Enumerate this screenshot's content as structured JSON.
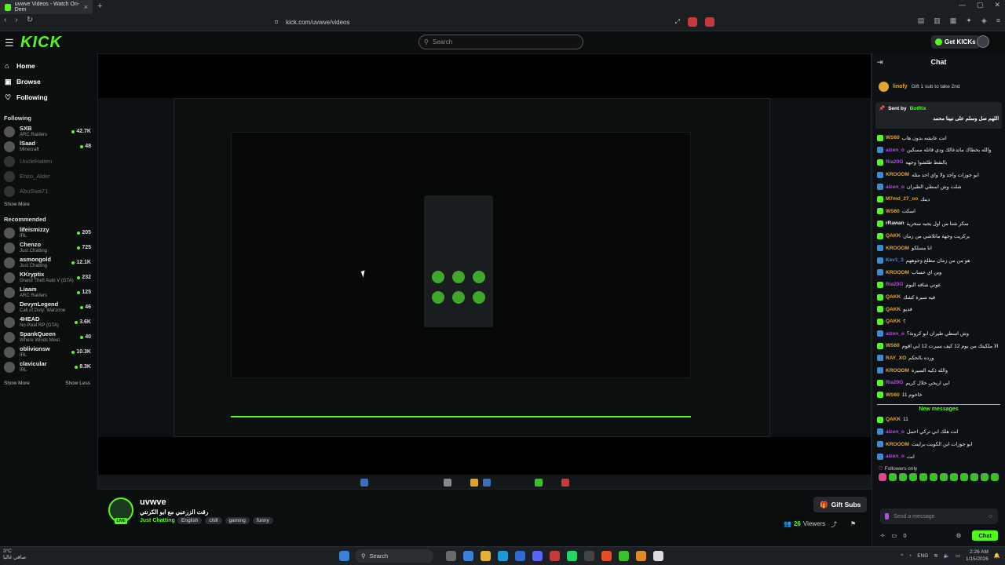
{
  "browser": {
    "tab_title": "uvwve Videos - Watch On-Dem",
    "url": "kick.com/uvwve/videos"
  },
  "header": {
    "logo": "KICK",
    "search_placeholder": "Search",
    "get_kicks": "Get KICKs"
  },
  "sidebar": {
    "nav": [
      {
        "label": "Home",
        "icon": "home-icon"
      },
      {
        "label": "Browse",
        "icon": "browse-icon"
      },
      {
        "label": "Following",
        "icon": "heart-icon"
      }
    ],
    "following_title": "Following",
    "following": [
      {
        "name": "SXB",
        "category": "ARC Raiders",
        "viewers": "42.7K",
        "online": true
      },
      {
        "name": "lSaad",
        "category": "Minecraft",
        "viewers": "48",
        "online": true
      },
      {
        "name": "UncleHatten",
        "category": "",
        "viewers": "",
        "online": false
      },
      {
        "name": "Enzo_Alder",
        "category": "",
        "viewers": "",
        "online": false
      },
      {
        "name": "AbuSwa71",
        "category": "",
        "viewers": "",
        "online": false
      }
    ],
    "show_more_following": "Show More",
    "recommended_title": "Recommended",
    "recommended": [
      {
        "name": "lifeismizzy",
        "category": "IRL",
        "viewers": "205"
      },
      {
        "name": "Chenzo",
        "category": "Just Chatting",
        "viewers": "725"
      },
      {
        "name": "asmongold",
        "category": "Just Chatting",
        "viewers": "12.1K"
      },
      {
        "name": "KKryptix",
        "category": "Grand Theft Auto V (GTA)",
        "viewers": "232"
      },
      {
        "name": "Liaam",
        "category": "ARC Raiders",
        "viewers": "125"
      },
      {
        "name": "DevynLegend",
        "category": "Call of Duty: Warzone",
        "viewers": "46"
      },
      {
        "name": "4HEAD",
        "category": "No Pixel RP (GTA)",
        "viewers": "3.6K"
      },
      {
        "name": "SpankQueen",
        "category": "Where Winds Meet",
        "viewers": "40"
      },
      {
        "name": "oblivionsw",
        "category": "IRL",
        "viewers": "10.3K"
      },
      {
        "name": "clavicular",
        "category": "IRL",
        "viewers": "8.3K"
      }
    ],
    "show_more": "Show More",
    "show_less": "Show Less"
  },
  "stream": {
    "streamer": "uvwve",
    "live_badge": "LIVE",
    "title": "رقت الزرعبي مع ابو الكرنتي",
    "category": "Just Chatting",
    "tags": [
      "English",
      "chill",
      "gaming",
      "funny"
    ],
    "gift_subs": "Gift Subs",
    "viewers": "26",
    "viewers_label": "Viewers"
  },
  "chat": {
    "title": "Chat",
    "goal_user": "linofy",
    "goal_text": "Gift 1 sub to take 2nd",
    "pinned_sent_by": "Sent by",
    "pinned_user": "BotRix",
    "pinned_message": "اللهم صل وسلم على نبينا محمد",
    "messages": [
      {
        "user": "WS60",
        "text": "انت عايشه بدون هاب",
        "color": "#e2a72a",
        "badge": "g"
      },
      {
        "user": "aizen_o",
        "text": "والله يحطاك ماتدعالك ودي قاتله مسكين",
        "color": "#b84de0",
        "badge": "b"
      },
      {
        "user": "Ria20G",
        "text": "بالنقط طلشوا وجهه",
        "color": "#b84de0",
        "badge": "g"
      },
      {
        "user": "KROOOM",
        "text": "ابو جوزات واحد ولا واي احد مثله",
        "color": "#e2a72a",
        "badge": "b"
      },
      {
        "user": "aizen_o",
        "text": "شلت وش اسطي الطيران",
        "color": "#b84de0",
        "badge": "b"
      },
      {
        "user": "M7md_27_oo",
        "text": "دينك",
        "color": "#e2a72a",
        "badge": "g"
      },
      {
        "user": "WS60",
        "text": "اسكت",
        "color": "#e2a72a",
        "badge": "g"
      },
      {
        "user": "rRawan",
        "text": "سكر شتا من اول يجيه سحرية",
        "color": "#eeeeee",
        "badge": "g"
      },
      {
        "user": "QAKK",
        "text": "يركريت وجهة ماتلاشي من زمان",
        "color": "#e2a72a",
        "badge": "g"
      },
      {
        "user": "KROOOM",
        "text": "انا مسلكو",
        "color": "#e2a72a",
        "badge": "b"
      },
      {
        "user": "Kev1_3",
        "text": "هو من من زمان مطلع وجوههم",
        "color": "#3f8bd1",
        "badge": "b"
      },
      {
        "user": "KROOOM",
        "text": "وين اي حساب",
        "color": "#e2a72a",
        "badge": "b"
      },
      {
        "user": "Ria20G",
        "text": "عوني شافه اليوم",
        "color": "#b84de0",
        "badge": "g"
      },
      {
        "user": "QAKK",
        "text": "فيه سيرة كشك",
        "color": "#e2a72a",
        "badge": "g"
      },
      {
        "user": "QAKK",
        "text": "فديو",
        "color": "#e2a72a",
        "badge": "g"
      },
      {
        "user": "QAKK",
        "text": "؟",
        "color": "#e2a72a",
        "badge": "g"
      },
      {
        "user": "aizen_o",
        "text": "وش اسطي طيران ابو كرونة؟",
        "color": "#b84de0",
        "badge": "b"
      },
      {
        "user": "WS60",
        "text": "الا ملكيتك من يوم 12 كيف سبرت 12 ابي اقوم",
        "color": "#e2a72a",
        "badge": "g"
      },
      {
        "user": "RAY_XO",
        "text": "ورده بالحكم",
        "color": "#e2a72a",
        "badge": "b"
      },
      {
        "user": "KROOOM",
        "text": "والله ذكيه السيرة",
        "color": "#e2a72a",
        "badge": "b"
      },
      {
        "user": "Ria20G",
        "text": "ابي اريحي حلال كريم",
        "color": "#b84de0",
        "badge": "g"
      },
      {
        "user": "WS60",
        "text": "11 خاخوم",
        "color": "#e2a72a",
        "badge": "g"
      }
    ],
    "new_messages": "New messages",
    "new_list": [
      {
        "user": "QAKK",
        "text": "11",
        "color": "#e2a72a",
        "badge": "g"
      },
      {
        "user": "aizen_o",
        "text": "انت هلك ابي تركي احمل",
        "color": "#b84de0",
        "badge": "b"
      },
      {
        "user": "KROOOM",
        "text": "ابو جوزات ابن الكويت برايتت",
        "color": "#e2a72a",
        "badge": "b"
      },
      {
        "user": "aizen_o",
        "text": "انت",
        "color": "#b84de0",
        "badge": "b"
      }
    ],
    "followers_only": "Followers only",
    "input_placeholder": "Send a message",
    "kicks_count": "0",
    "send_label": "Chat"
  },
  "taskbar": {
    "weather_temp": "3°C",
    "weather_text": "صافي غالبا",
    "search": "Search",
    "lang": "ENG",
    "time": "2:26 AM",
    "date": "1/15/2026"
  }
}
